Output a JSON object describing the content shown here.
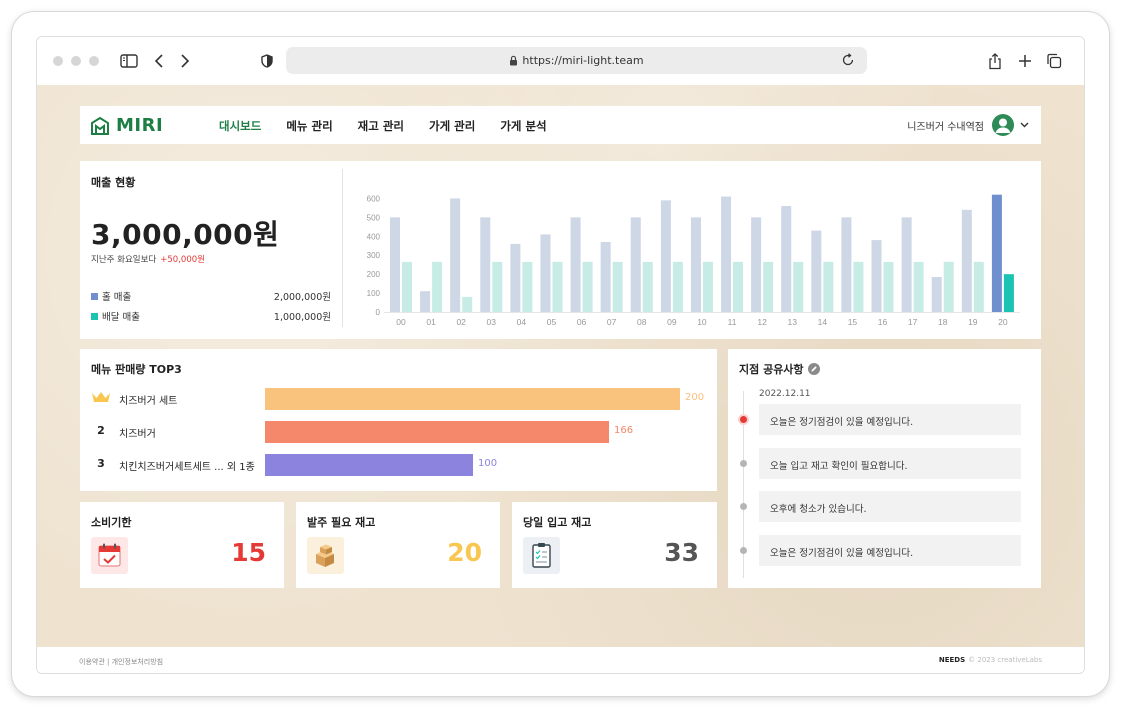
{
  "browser": {
    "url": "https://miri-light.team"
  },
  "nav": {
    "brand": "MIRI",
    "menu": [
      "대시보드",
      "메뉴 관리",
      "재고 관리",
      "가게 관리",
      "가게 분석"
    ],
    "active_index": 0,
    "store_name": "니즈버거 수내역점"
  },
  "sales": {
    "title": "매출 현황",
    "total": "3,000,000원",
    "compare_text": "지난주 화요일보다",
    "compare_delta": "+50,000원",
    "legend": [
      {
        "label": "홀 매출",
        "value": "2,000,000원",
        "color": "#6f8fcf"
      },
      {
        "label": "배달 매출",
        "value": "1,000,000원",
        "color": "#1bc3b2"
      }
    ]
  },
  "chart_data": {
    "type": "bar",
    "categories": [
      "00",
      "01",
      "02",
      "03",
      "04",
      "05",
      "06",
      "07",
      "08",
      "09",
      "10",
      "11",
      "12",
      "13",
      "14",
      "15",
      "16",
      "17",
      "18",
      "19",
      "20"
    ],
    "series": [
      {
        "name": "홀 매출",
        "values": [
          500,
          110,
          600,
          500,
          360,
          410,
          500,
          370,
          500,
          590,
          500,
          610,
          500,
          560,
          430,
          500,
          380,
          500,
          185,
          540,
          620
        ],
        "color": "#cdd7e6",
        "highlight_color": "#6f8fcf"
      },
      {
        "name": "배달 매출",
        "values": [
          265,
          265,
          80,
          265,
          265,
          265,
          265,
          265,
          265,
          265,
          265,
          265,
          265,
          265,
          265,
          265,
          265,
          265,
          265,
          265,
          200
        ],
        "color": "#c7ece6",
        "highlight_color": "#1bc3b2"
      }
    ],
    "highlight_index": 20,
    "y_ticks": [
      0,
      100,
      200,
      300,
      400,
      500,
      600
    ],
    "ylim": [
      0,
      650
    ],
    "grid": false
  },
  "top3": {
    "title": "메뉴 판매량 TOP3",
    "max": 200,
    "items": [
      {
        "rank": "",
        "crown": true,
        "name": "치즈버거 세트",
        "value": 200,
        "color": "#f9c27d",
        "value_color": "#f9c27d"
      },
      {
        "rank": "2",
        "crown": false,
        "name": "치즈버거",
        "value": 166,
        "color": "#f5876a",
        "value_color": "#f5876a"
      },
      {
        "rank": "3",
        "crown": false,
        "name": "치킨치즈버거세트세트 ... 외 1종",
        "value": 100,
        "color": "#8b83dd",
        "value_color": "#8b83dd"
      }
    ]
  },
  "stats": [
    {
      "title": "소비기한",
      "value": "15",
      "color": "#e53935"
    },
    {
      "title": "발주 필요 재고",
      "value": "20",
      "color": "#f9c74f"
    },
    {
      "title": "당일 입고 재고",
      "value": "33",
      "color": "#555555"
    }
  ],
  "notices": {
    "title": "지점 공유사항",
    "date": "2022.12.11",
    "items": [
      "오늘은 정기점검이 있을 예정입니다.",
      "오늘 입고 재고 확인이 필요합니다.",
      "오후에 청소가 있습니다.",
      "오늘은 정기점검이 있을 예정입니다."
    ]
  },
  "footer": {
    "links": "이용약관 | 개인정보처리방침",
    "brand": "NEEDS",
    "copyright": "© 2023 creativeLabs"
  }
}
